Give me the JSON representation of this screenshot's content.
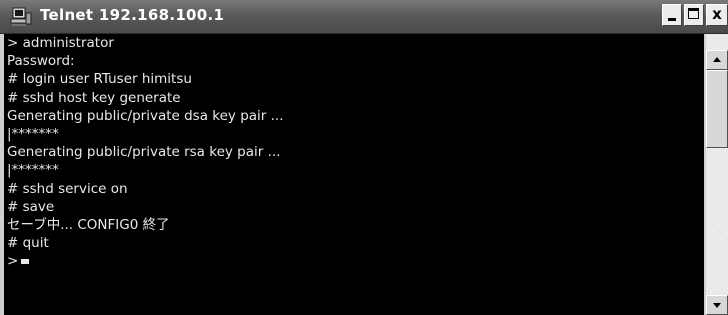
{
  "window": {
    "title": "Telnet 192.168.100.1",
    "icon": "telnet-computer-icon",
    "controls": {
      "minimize": "-",
      "maximize": "□",
      "close": "x"
    }
  },
  "console": {
    "lines": [
      "> administrator",
      "Password:",
      "# login user RTuser himitsu",
      "# sshd host key generate",
      "Generating public/private dsa key pair ...",
      "|*******",
      "Generating public/private rsa key pair ...",
      "|*******",
      "# sshd service on",
      "# save",
      "セーブ中... CONFIG0 終了",
      "# quit",
      ">"
    ],
    "text_color": "#e8e8e8",
    "background_color": "#000000"
  },
  "scrollbar": {
    "up_icon": "arrow-up-icon",
    "down_icon": "arrow-down-icon"
  }
}
